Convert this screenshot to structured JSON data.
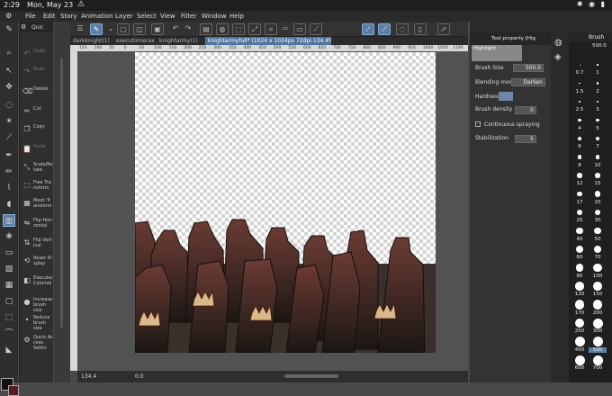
{
  "status": {
    "time": "2:29",
    "date": "Mon, May 23",
    "warn_icon": "warning-icon"
  },
  "menu": {
    "items": [
      "File",
      "Edit",
      "Story",
      "Animation",
      "Layer",
      "Select",
      "View",
      "Filter",
      "Window",
      "Help"
    ]
  },
  "tabs": [
    "darkknight(1)",
    "executionerax",
    "knightarmy(1)",
    "knightarmyfull* (1024 x 1024px 72dpi 134.4%)"
  ],
  "ruler": {
    "labels": [
      "150",
      "100",
      "50",
      "0",
      "50",
      "100",
      "150",
      "200",
      "250",
      "300",
      "350",
      "400",
      "450",
      "500",
      "550",
      "600",
      "650",
      "700",
      "750",
      "800",
      "850",
      "900",
      "950",
      "1000",
      "1050",
      "1100"
    ]
  },
  "subtools": {
    "header": "Quic",
    "items": [
      {
        "label": "Undo",
        "dim": true
      },
      {
        "label": "Redo",
        "dim": true
      },
      {
        "label": "Delete"
      },
      {
        "label": "Cut"
      },
      {
        "label": "Copy"
      },
      {
        "label": "Paste",
        "dim": true
      },
      {
        "label": "Scale/Ro tate"
      },
      {
        "label": "Free Tra nsform"
      },
      {
        "label": "Mesh Tr ansform"
      },
      {
        "label": "Flip Hori zontal"
      },
      {
        "label": "Flip Vert ical"
      },
      {
        "label": "Reset Di splay"
      },
      {
        "label": "Execute/ Colorize"
      },
      {
        "label": "Increase brush size"
      },
      {
        "label": "Reduce brush size"
      },
      {
        "label": "Quick Ac cess Settin"
      }
    ]
  },
  "toolprop": {
    "title": "Tool property [Hig",
    "highlight": "Highlight",
    "brush_size_label": "Brush Size",
    "brush_size": "500.0",
    "blending_label": "Blending mode",
    "blending": "Darken",
    "hardness_label": "Hardness",
    "density_label": "Brush density",
    "density": "0",
    "continuous_label": "Continuous spraying",
    "stabilization_label": "Stabilization",
    "stabilization": "5"
  },
  "brushpanel": {
    "title": "Brush",
    "value": "500.0",
    "sizes": [
      "0.7",
      "1",
      "1.5",
      "2",
      "2.5",
      "3",
      "4",
      "5",
      "6",
      "7",
      "8",
      "10",
      "12",
      "15",
      "17",
      "20",
      "25",
      "30",
      "40",
      "50",
      "60",
      "70",
      "80",
      "100",
      "120",
      "150",
      "170",
      "200",
      "250",
      "300",
      "400",
      "500",
      "600",
      "700"
    ]
  },
  "bottom": {
    "zoom": "134.4",
    "rotate": "0.0"
  }
}
